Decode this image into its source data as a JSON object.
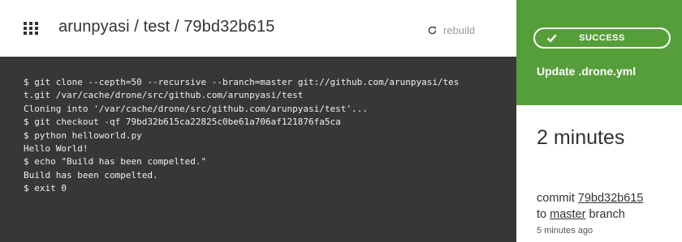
{
  "header": {
    "grid_icon": "grid-menu-icon",
    "title": "arunpyasi / test / 79bd32b615",
    "rebuild_icon": "refresh-icon",
    "rebuild_label": "rebuild"
  },
  "terminal": {
    "background": "#373737",
    "lines": [
      "$ git clone --cepth=50 --recursive --branch=master git://github.com/arunpyasi/tes",
      "t.git /var/cache/drone/src/github.com/arunpyasi/test",
      "Cloning into '/var/cache/drone/src/github.com/arunpyasi/test'...",
      "$ git checkout -qf 79bd32b615ca22825c0be61a706af121876fa5ca",
      "$ python helloworld.py",
      "Hello World!",
      "$ echo \"Build has been compelted.\"",
      "Build has been compelted.",
      "$ exit 0"
    ]
  },
  "status": {
    "color": "#569e3a",
    "icon": "check-icon",
    "label": "SUCCESS",
    "commit_message": "Update .drone.yml"
  },
  "details": {
    "duration": "2 minutes",
    "commit_prefix": "commit",
    "commit_hash": "79bd32b615",
    "to_label": "to",
    "branch": "master",
    "branch_suffix": "branch",
    "time_ago": "5 minutes ago"
  }
}
